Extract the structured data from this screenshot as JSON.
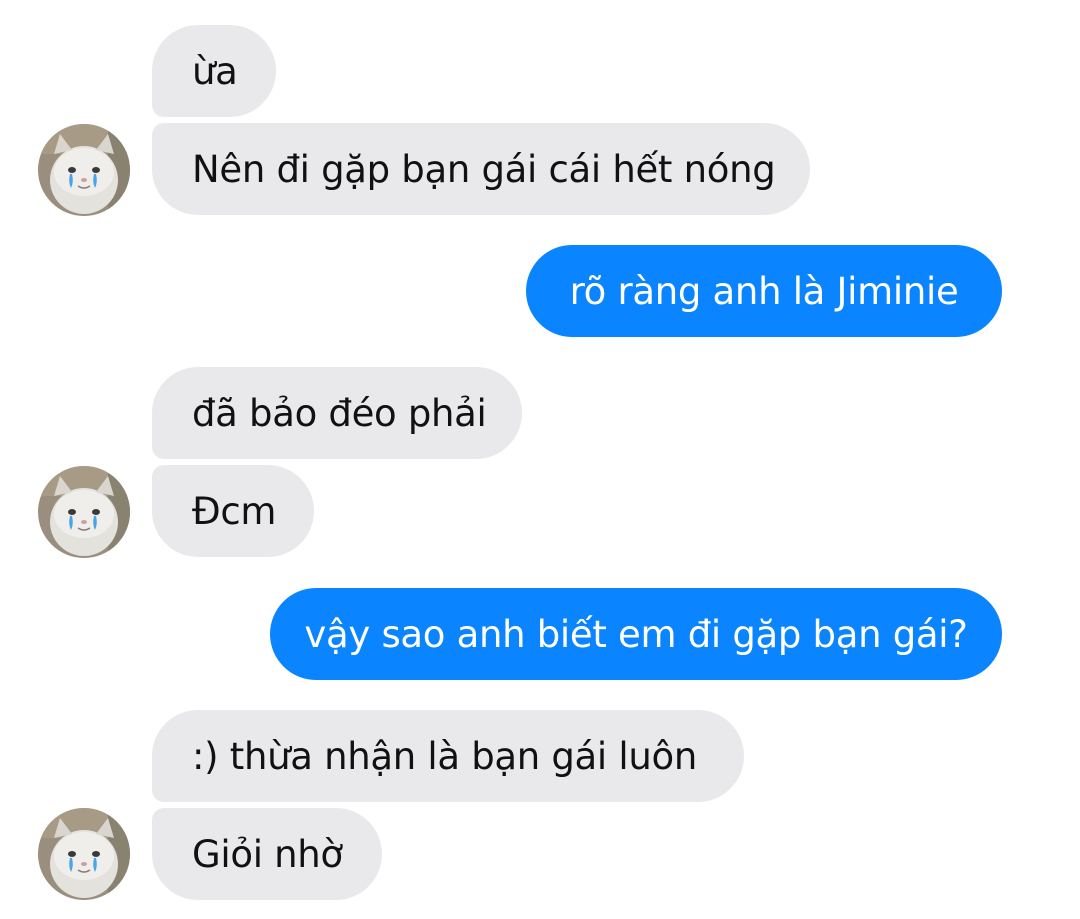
{
  "conversation": {
    "messages": [
      {
        "sender": "contact",
        "text": "ừa"
      },
      {
        "sender": "contact",
        "text": "Nên đi gặp bạn gái cái hết nóng"
      },
      {
        "sender": "me",
        "text": "rõ ràng anh là Jiminie"
      },
      {
        "sender": "contact",
        "text": "đã bảo đéo phải"
      },
      {
        "sender": "contact",
        "text": "Đcm"
      },
      {
        "sender": "me",
        "text": "vậy sao anh biết em đi gặp bạn gái?"
      },
      {
        "sender": "contact",
        "text": ":) thừa nhận là bạn gái luôn"
      },
      {
        "sender": "contact",
        "text": "Giỏi nhờ"
      }
    ],
    "avatar_icon": "crying-cat-avatar-icon"
  },
  "colors": {
    "incoming_bubble": "#e9e9eb",
    "outgoing_bubble": "#0a84ff",
    "incoming_text": "#111111",
    "outgoing_text": "#ffffff"
  }
}
